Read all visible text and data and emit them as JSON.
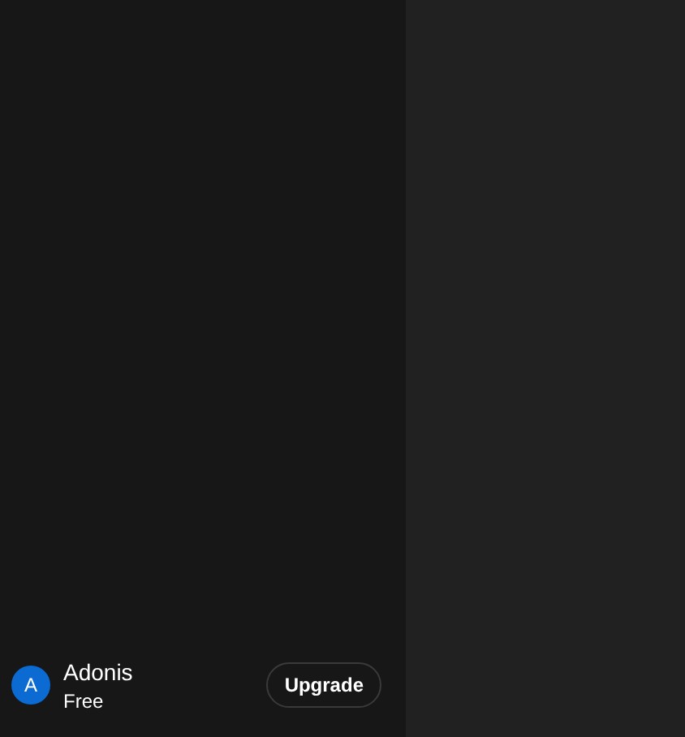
{
  "sidebar": {
    "user": {
      "initial": "A",
      "name": "Adonis",
      "plan": "Free"
    },
    "upgrade_button": "Upgrade"
  }
}
